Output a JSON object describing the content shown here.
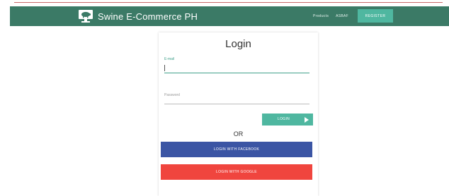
{
  "header": {
    "brand_title": "Swine E-Commerce PH",
    "nav": [
      "Products",
      "ASBAF"
    ],
    "register_label": "REGISTER"
  },
  "login": {
    "title": "Login",
    "email_label": "E-mail",
    "email_value": "",
    "password_label": "Password",
    "password_value": "",
    "submit_label": "LOGIN",
    "or_text": "OR",
    "facebook_label": "LOGIN WITH FACEBOOK",
    "google_label": "LOGIN WITH GOOGLE"
  },
  "colors": {
    "navbar": "#3b7a66",
    "accent": "#4fb7a0",
    "facebook": "#3b55a4",
    "google": "#f0453e"
  }
}
